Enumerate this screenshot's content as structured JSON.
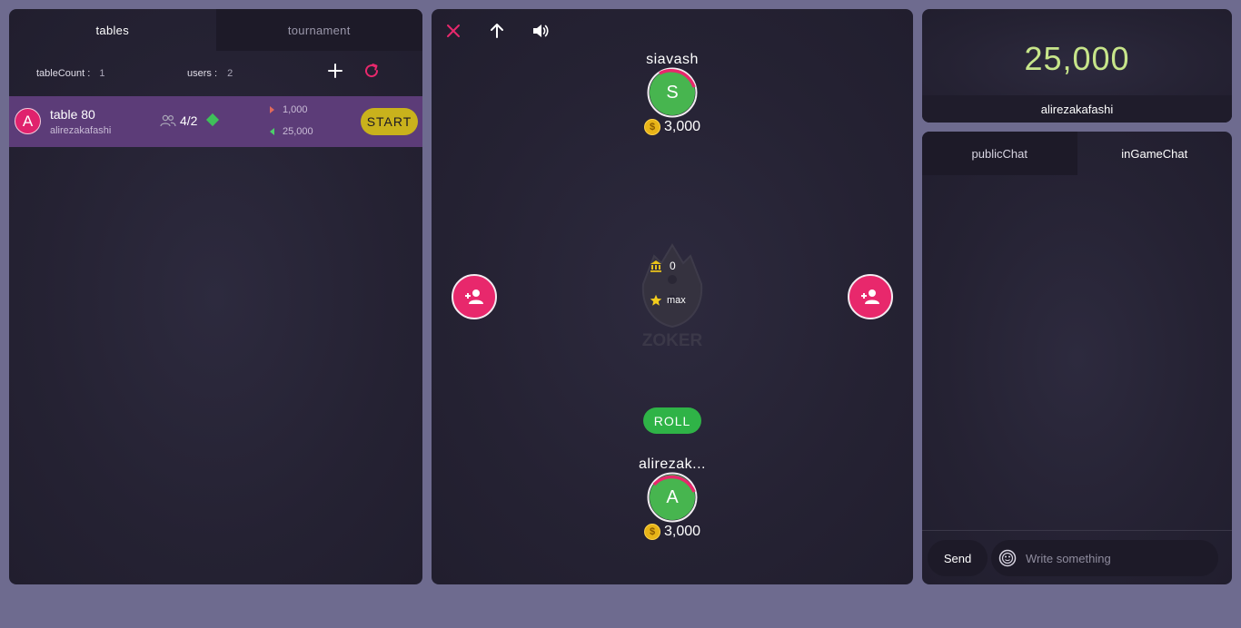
{
  "left_panel": {
    "tabs": [
      {
        "label": "tables",
        "active": true
      },
      {
        "label": "tournament",
        "active": false
      }
    ],
    "table_count_label": "tableCount :",
    "table_count_value": "1",
    "users_label": "users :",
    "users_value": "2",
    "add_icon": "plus-icon",
    "refresh_icon": "refresh-icon",
    "tables": [
      {
        "avatar_letter": "A",
        "name": "table 80",
        "owner": "alirezakafashi",
        "players": "4/2",
        "min_bet": "1,000",
        "max_bet": "25,000",
        "action_label": "START"
      }
    ]
  },
  "game": {
    "toolbar_icons": [
      "close-icon",
      "arrow-up-icon",
      "volume-icon"
    ],
    "top_player": {
      "name": "siavash",
      "letter": "S",
      "chips": "3,000"
    },
    "bottom_player": {
      "name": "alirezak...",
      "letter": "A",
      "chips": "3,000"
    },
    "pot_value": "0",
    "max_label": "max",
    "logo_text": "ZOKER",
    "roll_label": "ROLL"
  },
  "balance": {
    "amount": "25,000",
    "username": "alirezakafashi"
  },
  "chat": {
    "tabs": [
      {
        "label": "publicChat",
        "active": false
      },
      {
        "label": "inGameChat",
        "active": true
      }
    ],
    "send_label": "Send",
    "placeholder": "Write something"
  },
  "colors": {
    "accent_pink": "#e8286c",
    "accent_green": "#47b54f",
    "balance_green": "#c7e58a",
    "start_yellow": "#c9b21c"
  }
}
